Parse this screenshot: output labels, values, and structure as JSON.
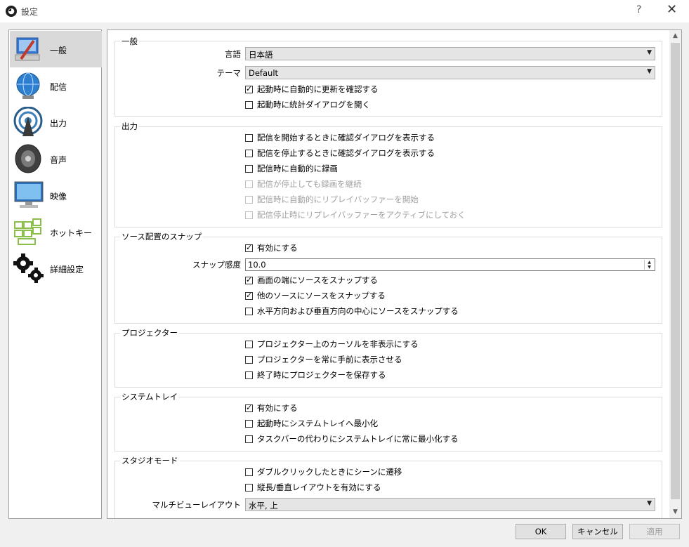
{
  "window": {
    "title": "設定",
    "help": "?",
    "close": "✕"
  },
  "sidebar": {
    "items": [
      {
        "label": "一般",
        "icon": "general-icon",
        "selected": true
      },
      {
        "label": "配信",
        "icon": "stream-globe-icon"
      },
      {
        "label": "出力",
        "icon": "output-broadcast-icon"
      },
      {
        "label": "音声",
        "icon": "speaker-icon"
      },
      {
        "label": "映像",
        "icon": "monitor-icon"
      },
      {
        "label": "ホットキー",
        "icon": "keyboard-icon"
      },
      {
        "label": "詳細設定",
        "icon": "gears-icon"
      }
    ]
  },
  "general": {
    "title": "一般",
    "language_label": "言語",
    "language_value": "日本語",
    "theme_label": "テーマ",
    "theme_value": "Default",
    "check_updates": "起動時に自動的に更新を確認する",
    "open_stats": "起動時に統計ダイアログを開く"
  },
  "output": {
    "title": "出力",
    "confirm_start": "配信を開始するときに確認ダイアログを表示する",
    "confirm_stop": "配信を停止するときに確認ダイアログを表示する",
    "auto_record": "配信時に自動的に録画",
    "keep_recording": "配信が停止しても録画を継続",
    "auto_replay": "配信時に自動的にリプレイバッファーを開始",
    "keep_replay": "配信停止時にリプレイバッファーをアクティブにしておく"
  },
  "snap": {
    "title": "ソース配置のスナップ",
    "enable": "有効にする",
    "sensitivity_label": "スナップ感度",
    "sensitivity_value": "10.0",
    "screen_edge": "画面の端にソースをスナップする",
    "other_sources": "他のソースにソースをスナップする",
    "center": "水平方向および垂直方向の中心にソースをスナップする"
  },
  "projector": {
    "title": "プロジェクター",
    "hide_cursor": "プロジェクター上のカーソルを非表示にする",
    "always_top": "プロジェクターを常に手前に表示させる",
    "save_on_exit": "終了時にプロジェクターを保存する"
  },
  "systray": {
    "title": "システムトレイ",
    "enable": "有効にする",
    "minimize_start": "起動時にシステムトレイへ最小化",
    "minimize_instead": "タスクバーの代わりにシステムトレイに常に最小化する"
  },
  "studio": {
    "title": "スタジオモード",
    "double_click": "ダブルクリックしたときにシーンに遷移",
    "portrait": "縦長/垂直レイアウトを有効にする",
    "multiview_label": "マルチビューレイアウト",
    "multiview_value": "水平, 上"
  },
  "footer": {
    "ok": "OK",
    "cancel": "キャンセル",
    "apply": "適用"
  }
}
